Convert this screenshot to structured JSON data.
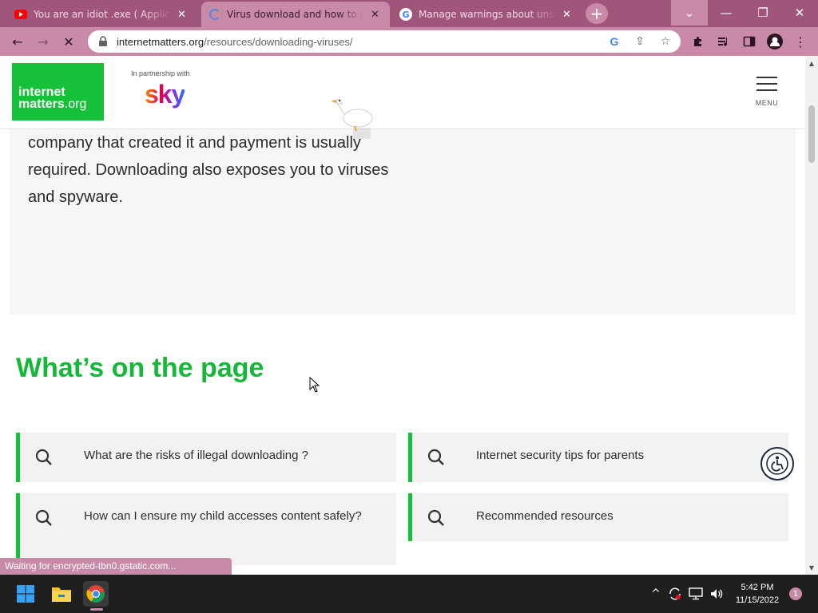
{
  "browser": {
    "tabs": [
      {
        "title": "You are an idiot .exe ( Application )",
        "favicon": "youtube-icon",
        "active": false
      },
      {
        "title": "Virus download and how to prevent it",
        "favicon": "loading-spinner-icon",
        "active": true
      },
      {
        "title": "Manage warnings about unsafe downloads",
        "favicon": "google-icon",
        "active": false
      }
    ],
    "new_tab": "+",
    "window_controls": {
      "tab_search": "⌄",
      "minimize": "—",
      "restore": "❐",
      "close": "✕"
    },
    "toolbar": {
      "back": "←",
      "forward": "→",
      "stop": "✕",
      "url_host": "internetmatters.org",
      "url_path": "/resources/downloading-viruses/"
    },
    "accent_color": "#c98aa8"
  },
  "page": {
    "logo": {
      "line1": "internet",
      "line2": "matters",
      "line2_suffix": ".org"
    },
    "partner_text": "In partnership with",
    "partner_logo": "sky",
    "menu_label": "MENU",
    "info_text": "company that created it and payment is usually required. Downloading also exposes you to viruses and spyware.",
    "section_heading": "What’s on the page",
    "links": [
      {
        "label": "What are the risks of illegal downloading ?"
      },
      {
        "label": "Internet security tips for parents"
      },
      {
        "label": "How can I ensure my child accesses content safely?"
      },
      {
        "label": "Recommended resources"
      }
    ],
    "brand_green": "#16c13a"
  },
  "status_bar": {
    "text": "Waiting for encrypted-tbn0.gstatic.com..."
  },
  "taskbar": {
    "time": "5:42 PM",
    "date": "11/15/2022",
    "notification_count": "1"
  }
}
